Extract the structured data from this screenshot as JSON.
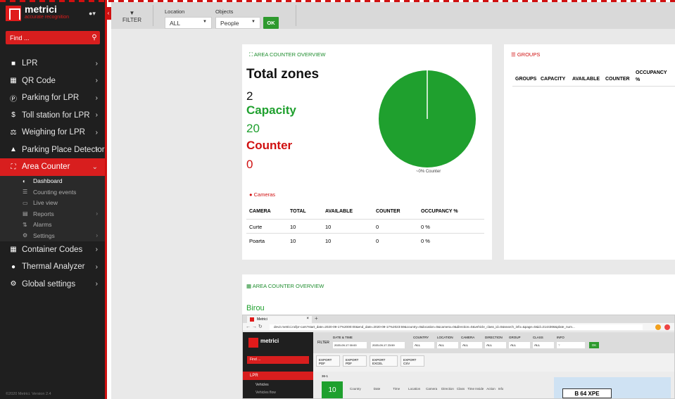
{
  "sidebar": {
    "logo_name": "metrici",
    "logo_tag": "accurate recognition",
    "find_placeholder": "Find ...",
    "items": [
      {
        "label": "LPR",
        "icon": "video-camera-icon"
      },
      {
        "label": "QR Code",
        "icon": "qr-code-icon"
      },
      {
        "label": "Parking for LPR",
        "icon": "parking-icon"
      },
      {
        "label": "Toll station for LPR",
        "icon": "dollar-icon"
      },
      {
        "label": "Weighing for LPR",
        "icon": "scale-icon"
      },
      {
        "label": "Parking Place Detector",
        "icon": "car-icon"
      },
      {
        "label": "Area Counter",
        "icon": "expand-icon"
      }
    ],
    "sub_items": [
      {
        "label": "Dashboard"
      },
      {
        "label": "Counting events"
      },
      {
        "label": "Live view"
      },
      {
        "label": "Reports"
      },
      {
        "label": "Alarms"
      },
      {
        "label": "Settings"
      }
    ],
    "items_after": [
      {
        "label": "Container Codes"
      },
      {
        "label": "Thermal Analyzer"
      },
      {
        "label": "Global settings"
      }
    ],
    "footer": "©2020 Metrici. Version 2.4"
  },
  "filter": {
    "filter_label": "FILTER",
    "location_label": "Location",
    "location_value": "ALL",
    "objects_label": "Objects",
    "objects_value": "People",
    "ok_label": "OK"
  },
  "overview": {
    "title": "AREA COUNTER OVERVIEW",
    "total_zones_label": "Total zones",
    "total_zones_value": "2",
    "capacity_label": "Capacity",
    "capacity_value": "20",
    "counter_label": "Counter",
    "counter_value": "0",
    "pie_label": "~0% Counter",
    "pie_counter_fraction": 0.0,
    "colors": {
      "capacity": "#1fa02e",
      "counter": "#d01010"
    }
  },
  "cameras": {
    "title": "Cameras",
    "columns": [
      "CAMERA",
      "TOTAL",
      "AVAILABLE",
      "COUNTER",
      "OCCUPANCY %"
    ],
    "rows": [
      [
        "Curte",
        "10",
        "10",
        "0",
        "0 %"
      ],
      [
        "Poarta",
        "10",
        "10",
        "0",
        "0 %"
      ]
    ]
  },
  "groups": {
    "title": "GROUPS",
    "columns": [
      "GROUPS",
      "CAPACITY",
      "AVAILABLE",
      "COUNTER",
      "OCCUPANCY %"
    ]
  },
  "overview2": {
    "title": "AREA COUNTER OVERVIEW",
    "zone_name": "Birou"
  },
  "embedded": {
    "tab_title": "Metrici",
    "url": "dev2.metrici.ro/lpr-cars?start_date=2020-09-17%2000:00&end_date=2020-09-17%2023:59&country=0&location=0&camera=0&direction=0&vehicle_class_id=0&search_info=&page=0&id=2144366&plate_num...",
    "filter_label": "FILTER",
    "date_time_label": "DATE & TIME",
    "date_start": "2020-09-17 00:00",
    "date_end": "2020-09-17 23:59",
    "country_label": "COUNTRY",
    "location_label": "LOCATION",
    "camera_label": "CAMERA",
    "direction_label": "DIRECTION",
    "group_label": "GROUP",
    "class_label": "CLASS",
    "info_label": "INFO",
    "all": "ALL",
    "info_placeholder": "?",
    "ok_label": "OK",
    "exports": [
      "EXPORT PDF",
      "EXPORT PDF",
      "EXPORT EXCEL",
      "EXPORT CSV"
    ],
    "side_items": [
      "LPR",
      "Vehicles",
      "Vehicles flow"
    ],
    "find_placeholder": "Find ...",
    "badge_top": "36-1",
    "badge_value": "10",
    "table_headers": [
      "Country",
      "Date",
      "Time",
      "Location",
      "Camera",
      "Direction",
      "Class",
      "Time Inside",
      "Action",
      "Info"
    ],
    "plate": "B 64 XPE"
  }
}
